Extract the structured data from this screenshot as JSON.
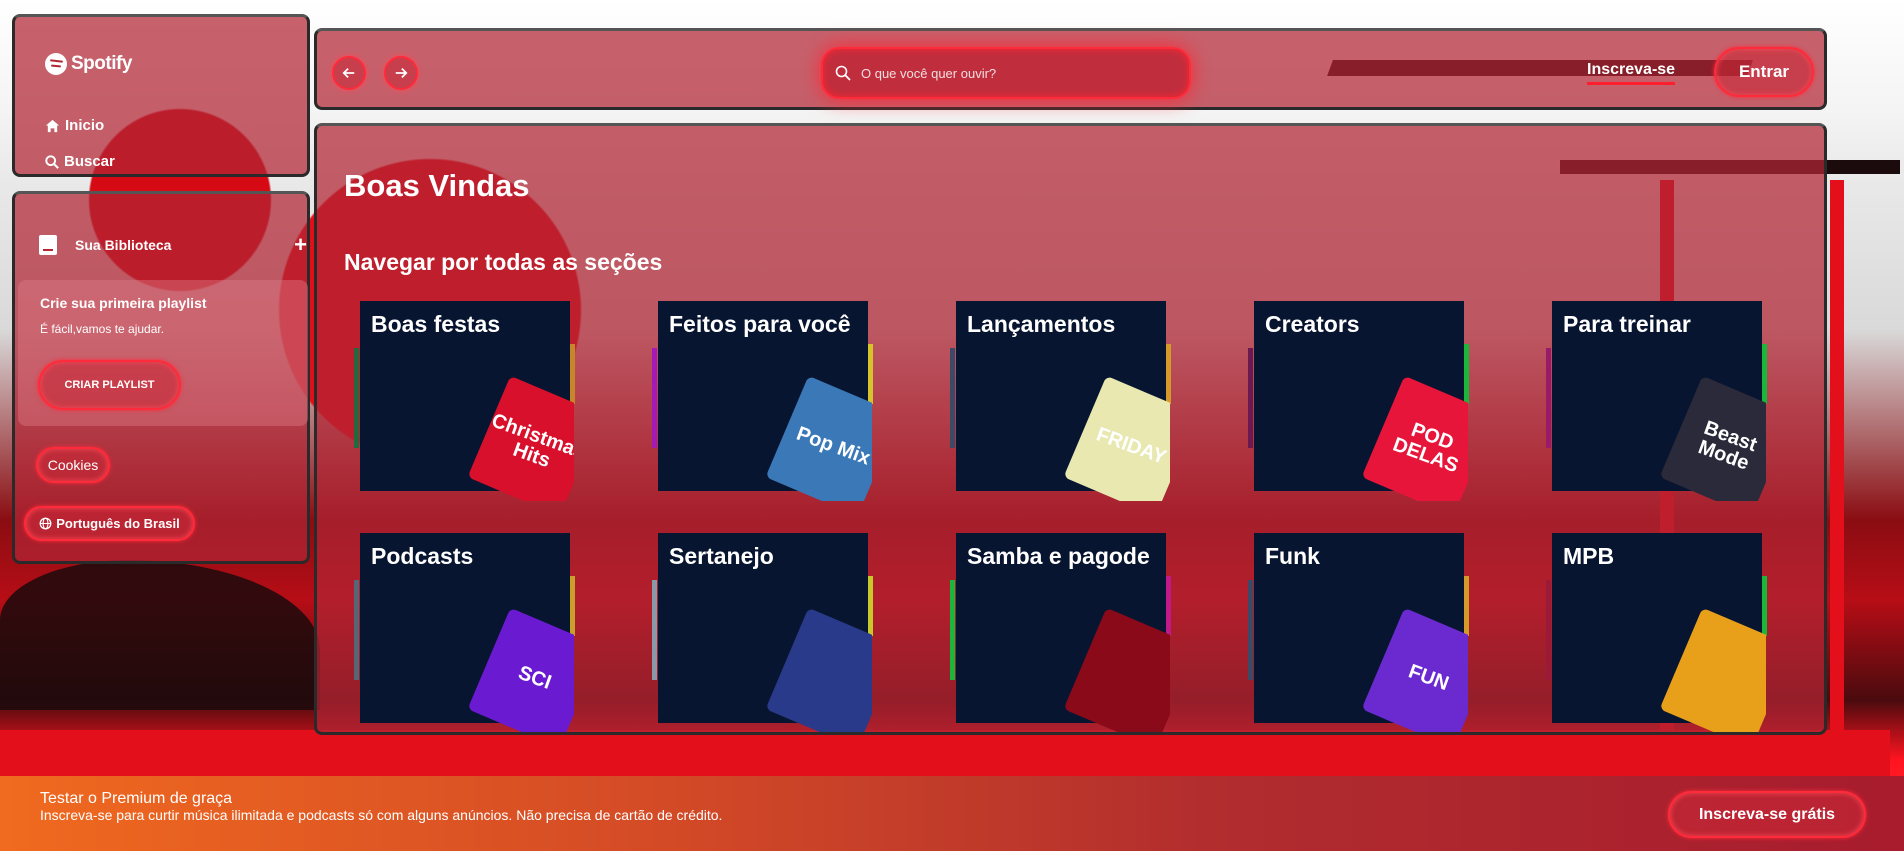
{
  "sidebar": {
    "logo_text": "Spotify",
    "nav": [
      {
        "label": "Inicio",
        "icon": "home-icon"
      },
      {
        "label": "Buscar",
        "icon": "search-icon"
      }
    ],
    "library": {
      "title": "Sua Biblioteca",
      "create_card": {
        "title": "Crie sua primeira playlist",
        "subtitle": "É fácil,vamos te ajudar.",
        "button": "CRIAR PLAYLIST"
      },
      "cookies_button": "Cookies",
      "language_button": "Português do Brasil"
    }
  },
  "topbar": {
    "search_placeholder": "O que você quer ouvir?",
    "signup_link": "Inscreva-se",
    "login_button": "Entrar"
  },
  "main": {
    "title": "Boas Vindas",
    "section_title": "Navegar por todas as seções",
    "cards": [
      {
        "title": "Boas festas",
        "art_text": "Christmas Hits",
        "art_color": "#d8102b",
        "stripe_left": "#1f6a3e",
        "stripe_right": "#c8862a"
      },
      {
        "title": "Feitos para você",
        "art_text": "Pop Mix",
        "art_color": "#3a78b8",
        "stripe_left": "#a31ab8",
        "stripe_right": "#d6c22a"
      },
      {
        "title": "Lançamentos",
        "art_text": "FRIDAY",
        "art_color": "#e8e8b0",
        "stripe_left": "#3b4a66",
        "stripe_right": "#d49a2a"
      },
      {
        "title": "Creators",
        "art_text": "POD DELAS",
        "art_color": "#e8153a",
        "stripe_left": "#6a1a50",
        "stripe_right": "#1ab83a"
      },
      {
        "title": "Para treinar",
        "art_text": "Beast Mode",
        "art_color": "#2a2a3a",
        "stripe_left": "#9a1a6a",
        "stripe_right": "#1ab83a"
      },
      {
        "title": "Podcasts",
        "art_text": "SCI",
        "art_color": "#6a1ad0",
        "stripe_left": "#556677",
        "stripe_right": "#c8a02a"
      },
      {
        "title": "Sertanejo",
        "art_text": "",
        "art_color": "#2a3a8a",
        "stripe_left": "#8899aa",
        "stripe_right": "#c8c82a"
      },
      {
        "title": "Samba e pagode",
        "art_text": "",
        "art_color": "#8a0a1a",
        "stripe_left": "#1ab83a",
        "stripe_right": "#c01a8a"
      },
      {
        "title": "Funk",
        "art_text": "FUN",
        "art_color": "#6a2ad0",
        "stripe_left": "#3b4a66",
        "stripe_right": "#d49a2a"
      },
      {
        "title": "MPB",
        "art_text": "",
        "art_color": "#e8a01a",
        "stripe_left": "#9a1a3a",
        "stripe_right": "#1ab83a"
      }
    ]
  },
  "banner": {
    "title": "Testar o Premium de graça",
    "subtitle": "Inscreva-se para curtir música ilimitada e podcasts só com alguns anúncios. Não precisa de cartão de crédito.",
    "button": "Inscreva-se grátis"
  },
  "colors": {
    "accent": "#ff2a3a",
    "panel": "#b22634",
    "card_bg": "#081530"
  }
}
